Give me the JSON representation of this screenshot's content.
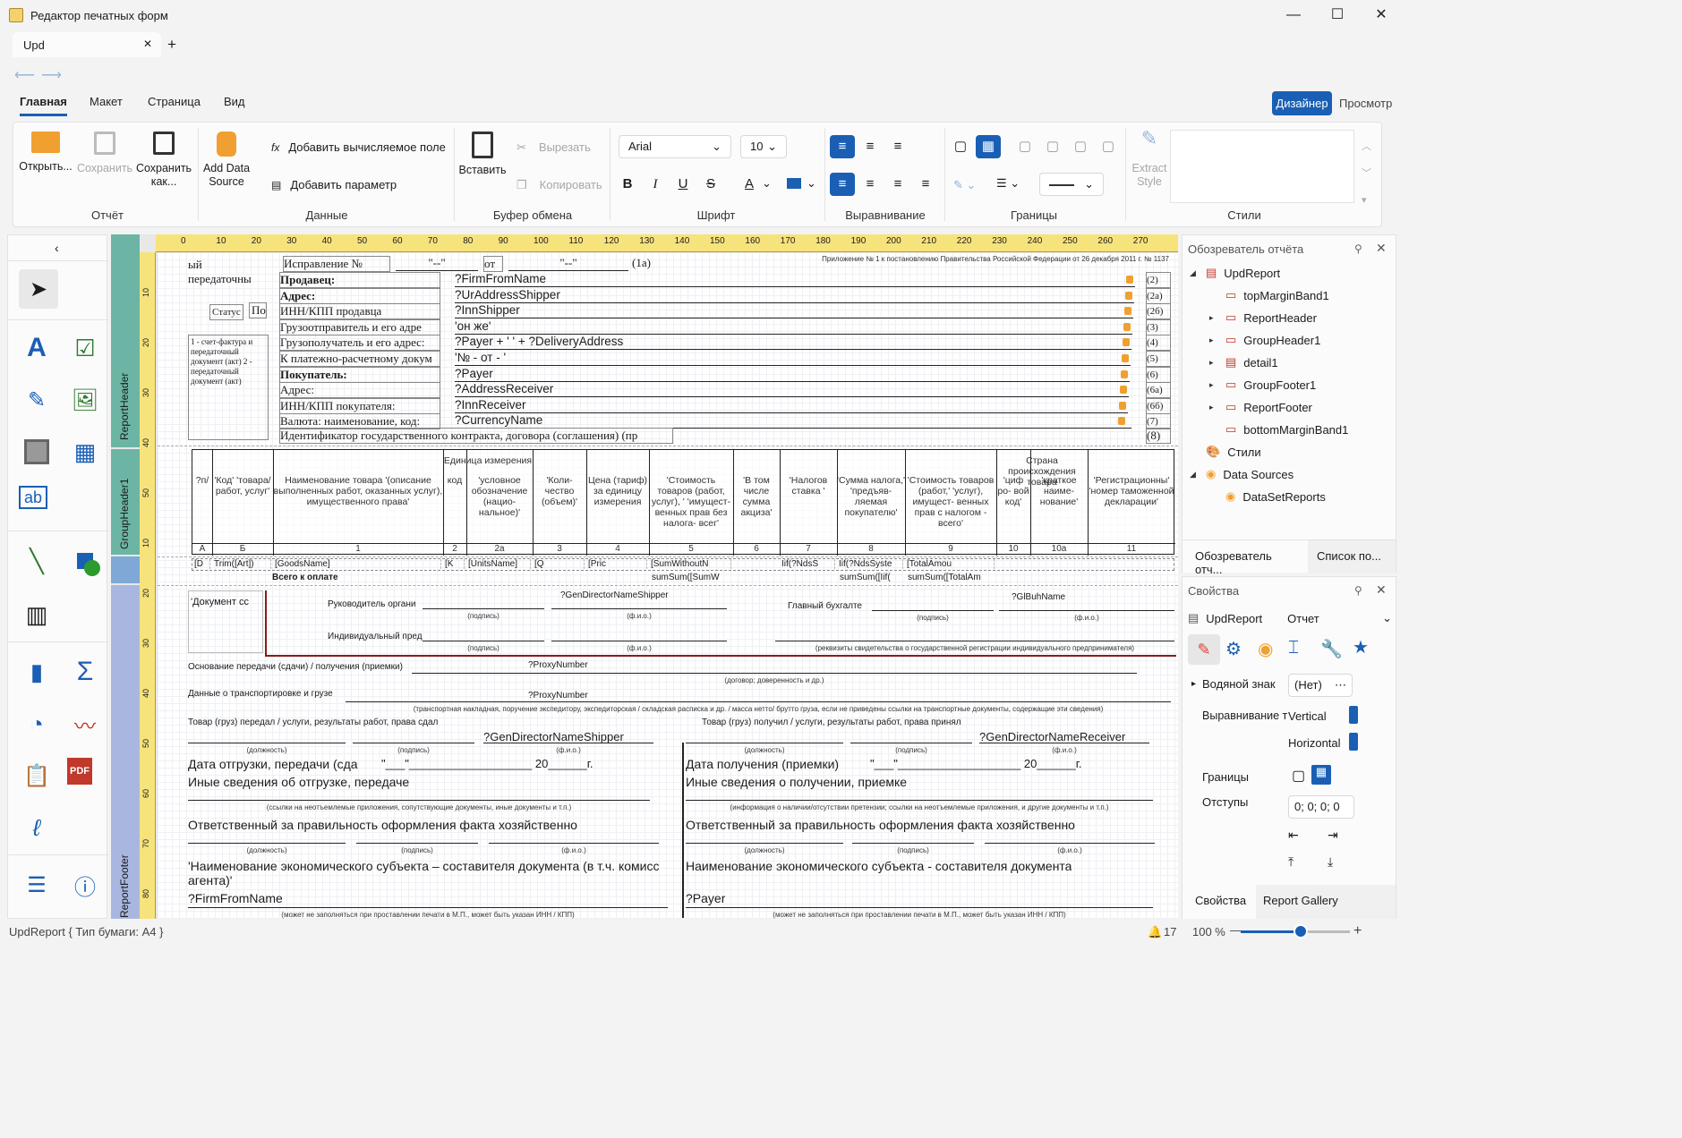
{
  "window": {
    "title": "Редактор печатных форм",
    "tab": "Upd",
    "add_tab": "+"
  },
  "menu": {
    "tabs": [
      "Главная",
      "Макет",
      "Страница",
      "Вид"
    ],
    "designer": "Дизайнер",
    "preview": "Просмотр"
  },
  "ribbon": {
    "report": {
      "open": "Открыть...",
      "save": "Сохранить",
      "save_as": "Сохранить как...",
      "add_ds": "Add Data Source",
      "label": "Отчёт"
    },
    "data": {
      "calc_field": "Добавить вычисляемое поле",
      "param": "Добавить параметр",
      "label": "Данные"
    },
    "clipboard": {
      "paste": "Вставить",
      "cut": "Вырезать",
      "copy": "Копировать",
      "label": "Буфер обмена"
    },
    "font": {
      "family": "Arial",
      "size": "10",
      "label": "Шрифт"
    },
    "align": {
      "label": "Выравнивание"
    },
    "borders": {
      "label": "Границы"
    },
    "styles": {
      "extract": "Extract Style",
      "label": "Стили"
    }
  },
  "bands": {
    "report_header": "ReportHeader",
    "group_header": "GroupHeader1",
    "report_footer": "ReportFooter"
  },
  "ruler_h": [
    "0",
    "10",
    "20",
    "30",
    "40",
    "50",
    "60",
    "70",
    "80",
    "90",
    "100",
    "110",
    "120",
    "130",
    "140",
    "150",
    "160",
    "170",
    "180",
    "190",
    "200",
    "210",
    "220",
    "230",
    "240",
    "250",
    "260",
    "270"
  ],
  "ruler_v": [
    "10",
    "20",
    "30",
    "40",
    "50",
    "10",
    "20",
    "30",
    "40",
    "50",
    "60",
    "70",
    "80"
  ],
  "form": {
    "top_left1": "ый",
    "top_left2": "передаточны",
    "status_lbl": "Статус",
    "status_val": "По",
    "type_note": "1 - счет-фактура и передаточный документ (акт) 2 - передаточный документ (акт)",
    "correction": "Исправление №",
    "dash1": "\"--\"",
    "from": "от",
    "dash2": "\"--\"",
    "note_1a": "(1а)",
    "header_note": "Приложение № 1 к постановлению Правительства Российской Федерации от 26 декабря 2011 г. № 1137",
    "rows": [
      {
        "label": "Продавец:",
        "bold": true,
        "value": "?FirmFromName",
        "code": "(2)"
      },
      {
        "label": "Адрес:",
        "bold": true,
        "value": "?UrAddressShipper",
        "code": "(2а)"
      },
      {
        "label": "ИНН/КПП продавца",
        "bold": false,
        "value": "?InnShipper",
        "code": "(2б)"
      },
      {
        "label": "Грузоотправитель и его адре",
        "bold": false,
        "value": "'он же'",
        "code": "(3)"
      },
      {
        "label": "Грузополучатель и его адрес:",
        "bold": false,
        "value": "?Payer + ' ' + ?DeliveryAddress",
        "code": "(4)"
      },
      {
        "label": "К платежно-расчетному докум",
        "bold": false,
        "value": "'№  -  от  -  '",
        "code": "(5)"
      },
      {
        "label": "Покупатель:",
        "bold": true,
        "value": "?Payer",
        "code": "(6)"
      },
      {
        "label": "Адрес:",
        "bold": false,
        "value": "?AddressReceiver",
        "code": "(6а)"
      },
      {
        "label": "ИНН/КПП покупателя:",
        "bold": false,
        "value": "?InnReceiver",
        "code": "(6б)"
      },
      {
        "label": "Валюта: наименование, код:",
        "bold": false,
        "value": "?CurrencyName",
        "code": "(7)"
      }
    ],
    "gov_id": "Идентификатор государственного контракта, договора (соглашения) (пр",
    "gov_code": "(8)",
    "table_heads": [
      "?п/",
      "'Код' 'товара/ работ, услуг'",
      "Наименование товара '(описание выполненных работ, оказанных услуг), имущественного права'",
      "Единица измерения",
      "код",
      "'условное обозначение (нацио- нальное)'",
      "'Коли- чество (объем)'",
      "Цена (тариф) за единицу измерения",
      "'Стоимость товаров (работ, услуг), ' 'имущест- венных прав без налога- всег'",
      "'В том числе сумма акциза'",
      "'Налогов ставка '",
      "'Сумма налога,' 'предъяв- ляемая покупателю'",
      "'Стоимость товаров (работ,' 'услуг), имущест- венных прав с налогом - всего'",
      "Страна происхождения товара",
      "'циф ро- вой код'",
      "'краткое наиме- нование'",
      "'Регистрационны' 'номер таможенной декларации'"
    ],
    "col_nums": [
      "А",
      "Б",
      "1",
      "2",
      "2а",
      "3",
      "4",
      "5",
      "6",
      "7",
      "8",
      "9",
      "10",
      "10а",
      "11"
    ],
    "detail": [
      "[D",
      "Trim([Art])",
      "[GoodsName]",
      "[K",
      "[UnitsName]",
      "[Q",
      "[Pric",
      "[SumWithoutN",
      "",
      "Iif(?NdsS",
      "Iif(?NdsSyste",
      "[TotalAmou",
      "",
      "",
      ""
    ],
    "footer_total": "Всего к оплате",
    "sums": [
      "sumSum([SumW",
      "sumSum([Iif(",
      "sumSum([TotalAm"
    ],
    "doc_label": "'Документ сс",
    "director": "Руководитель органи",
    "gen_dir": "?GenDirectorNameShipper",
    "chief_acc": "Главный бухгалте",
    "glbuh": "?GlBuhName",
    "signature": "(подпись)",
    "fio": "(ф.и.о.)",
    "indiv": "Индивидуальный пред",
    "reg_note": "(реквизиты свидетельства о государственной регистрации индивидуального предпринимателя)",
    "basis": "Основание передачи (сдачи) / получения (приемки)",
    "proxy": "?ProxyNumber",
    "contract_note": "(договор; доверенность и др.)",
    "transport": "Данные о транспортировке и грузе",
    "transport_note": "(транспортная накладная, поручение экспедитору, экспедиторская / складская расписка и др. / масса нетто/ брутто груза, если не приведены ссылки на транспортные документы, содержащие эти сведения)",
    "goods_passed": "Товар (груз) передал / услуги, результаты работ, права сдал",
    "goods_received": "Товар (груз) получил / услуги, результаты работ, права принял",
    "gen_dir_recv": "?GenDirectorNameReceiver",
    "position": "(должность)",
    "ship_date": "Дата отгрузки, передачи (сда",
    "recv_date": "Дата получения (приемки)",
    "date_blank": "\"___\"___________________ 20______г.",
    "other_ship": "Иные сведения об отгрузке, передаче",
    "other_recv": "Иные сведения о получении, приемке",
    "other_ship_note": "(ссылки на неотъемлемые приложения, сопутствующие документы, иные документы и т.п.)",
    "other_recv_note": "(информация о наличии/отсутствии претензии; ссылки на неотъемлемые приложения, и другие документы и т.п.)",
    "responsible": "Ответственный за правильность оформления факта хозяйственно",
    "entity_left": "'Наименование экономического субъекта – составителя документа (в т.ч. комисс агента)'",
    "entity_right": "Наименование экономического субъекта - составителя документа",
    "firm_from": "?FirmFromName",
    "payer": "?Payer",
    "stamp_note": "(может не заполняться при проставлении печати в М.П., может быть указан ИНН / КПП)"
  },
  "explorer": {
    "title": "Обозреватель отчёта",
    "items": [
      "UpdReport",
      "topMarginBand1",
      "ReportHeader",
      "GroupHeader1",
      "detail1",
      "GroupFooter1",
      "ReportFooter",
      "bottomMarginBand1",
      "Стили",
      "Data Sources",
      "DataSetReports"
    ],
    "tabs": [
      "Обозреватель отч...",
      "Список по..."
    ]
  },
  "properties": {
    "title": "Свойства",
    "object": "UpdReport",
    "object_type": "Отчет",
    "watermark": "Водяной знак",
    "watermark_val": "(Нет)",
    "align_label": "Выравнивание т",
    "vertical": "Vertical",
    "horizontal": "Horizontal",
    "borders": "Границы",
    "padding": "Отступы",
    "padding_val": "0; 0; 0; 0",
    "tabs": [
      "Свойства",
      "Report Gallery"
    ]
  },
  "status": {
    "text": "UpdReport { Тип бумаги: A4 }",
    "notif": "17",
    "zoom": "100 %",
    "zoom_level": 0.55
  }
}
